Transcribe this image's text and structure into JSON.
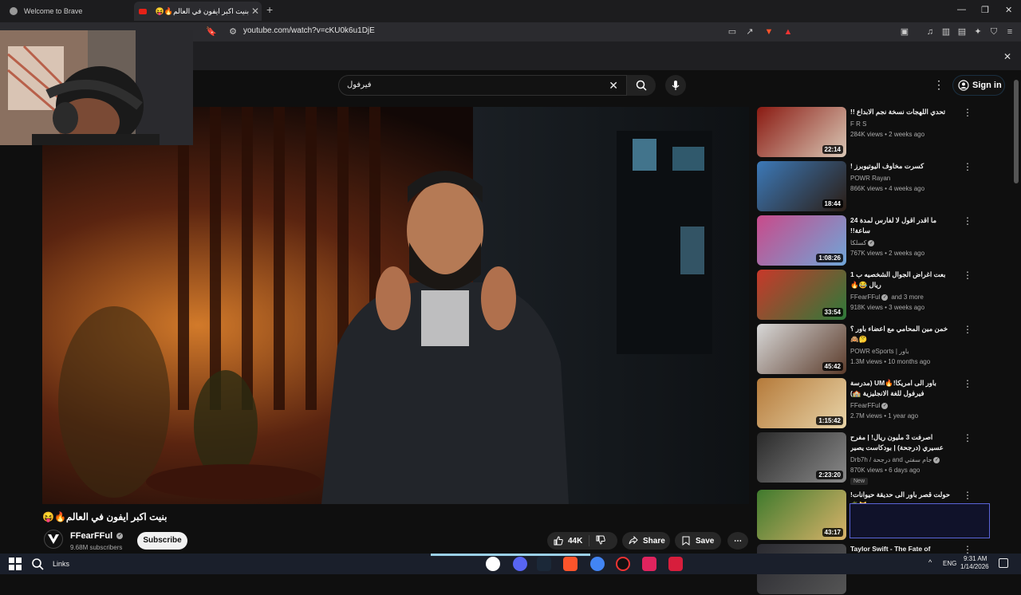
{
  "browser": {
    "tabs": [
      {
        "title": "Welcome to Brave"
      },
      {
        "title": "بنيت اكبر ايفون في العالم🔥😝 -"
      }
    ],
    "new_tab": "+",
    "url": "youtube.com/watch?v=cKU0k6u1DjE",
    "window_controls": [
      "—",
      "❐",
      "✕"
    ],
    "brave_shield_count": "1"
  },
  "header": {
    "search_value": "فيرفول",
    "signin_label": "Sign in"
  },
  "video": {
    "title": "بنيت اكبر ايفون في العالم🔥😝",
    "channel_name": "FFearFFul",
    "channel_subs": "9.68M subscribers",
    "subscribe_label": "Subscribe",
    "likes": "44K",
    "share_label": "Share",
    "save_label": "Save"
  },
  "sidebar": {
    "items": [
      {
        "title": "تحدي اللهجات نسخة نجم الابداع !!",
        "channel": "F R S",
        "meta": "284K views • 2 weeks ago",
        "duration": "22:14",
        "verified": false,
        "colors": [
          "#8a1a12",
          "#d9c7b5"
        ]
      },
      {
        "title": "كسرت مخاوف اليوتيوبرز !",
        "channel": "POWR Rayan",
        "meta": "866K views • 4 weeks ago",
        "duration": "18:44",
        "verified": false,
        "colors": [
          "#3c79b8",
          "#2b1d14"
        ]
      },
      {
        "title": "ما اقدر اقول لا لفارس لمدة 24 ساعة!!",
        "channel": "كسلكا",
        "meta": "767K views • 2 weeks ago",
        "duration": "1:08:26",
        "verified": true,
        "colors": [
          "#c94a8a",
          "#6fa6d8"
        ]
      },
      {
        "title": "بعت اغراض الجوال الشخصيه ب 1 ريال 😂🔥",
        "channel": "FFearFFul",
        "channel_extra": "and 3 more",
        "meta": "918K views • 3 weeks ago",
        "duration": "33:54",
        "verified": true,
        "colors": [
          "#c8382a",
          "#2d7a3a"
        ]
      },
      {
        "title": "خمن مين المحامي مع اعضاء باور ؟ 🤔🙈",
        "channel": "POWR eSports | باور",
        "meta": "1.3M views • 10 months ago",
        "duration": "45:42",
        "verified": false,
        "colors": [
          "#d8d8d8",
          "#5b3b2a"
        ]
      },
      {
        "title": "باور الى امريكا!🔥UM (مدرسة فيرفول للغة الانجليزية 🏫)",
        "channel": "FFearFFul",
        "meta": "2.7M views • 1 year ago",
        "duration": "1:15:42",
        "verified": true,
        "colors": [
          "#b57a3a",
          "#e8d4a8"
        ]
      },
      {
        "title": "اصرفت 3 مليون ريال! | مفرح عسيري (درجحة) | بودكاست يصير خير",
        "channel": "Drb7h / درجحة and جام سفتي",
        "meta": "870K views • 6 days ago",
        "duration": "2:23:20",
        "verified": true,
        "is_new": true,
        "new_label": "New",
        "colors": [
          "#2a2a2a",
          "#8a8a8a"
        ]
      },
      {
        "title": "حولت قصر باور الى حديقة حيوانات!😼🌴",
        "channel": "",
        "meta": "",
        "duration": "43:17",
        "verified": false,
        "colors": [
          "#3f7a2d",
          "#d9b36a"
        ]
      },
      {
        "title": "Taylor Swift - The Fate of",
        "channel": "",
        "meta": "",
        "duration": "",
        "verified": false,
        "colors": [
          "#2a2a30",
          "#555"
        ]
      }
    ]
  },
  "taskbar": {
    "links_label": "Links",
    "language": "ENG",
    "time": "9:31 AM",
    "date": "1/14/2026"
  }
}
